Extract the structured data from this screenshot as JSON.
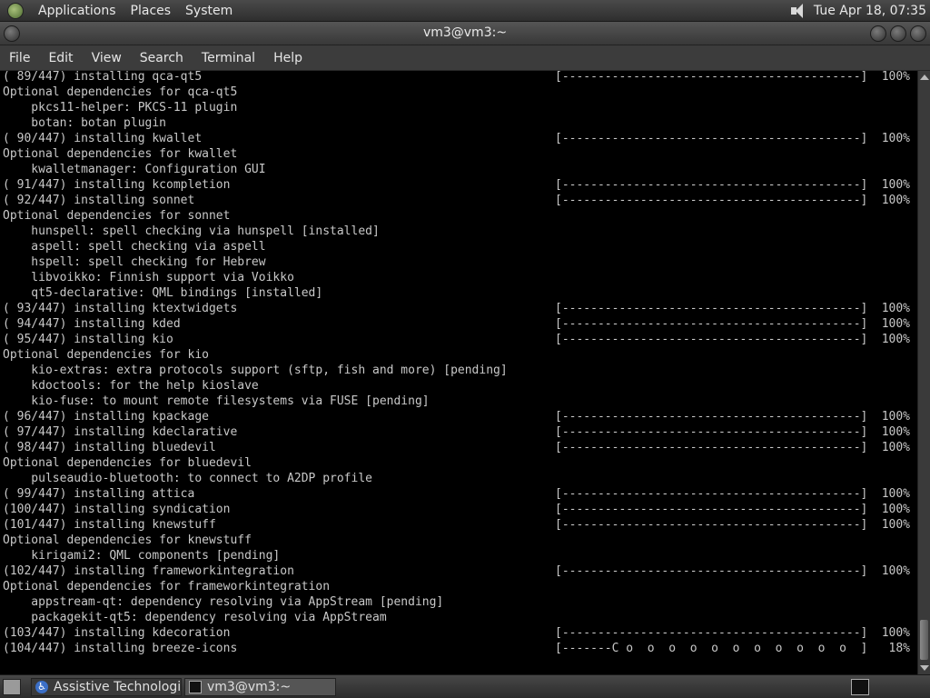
{
  "top_panel": {
    "menus": [
      "Applications",
      "Places",
      "System"
    ],
    "clock": "Tue Apr 18, 07:35"
  },
  "window": {
    "title": "vm3@vm3:~",
    "menubar": [
      "File",
      "Edit",
      "View",
      "Search",
      "Terminal",
      "Help"
    ]
  },
  "terminal_lines": [
    {
      "text": "( 89/447) installing qca-qt5",
      "bar": "[------------------------------------------]",
      "pct": "100%"
    },
    {
      "text": "Optional dependencies for qca-qt5"
    },
    {
      "text": "    pkcs11-helper: PKCS-11 plugin"
    },
    {
      "text": "    botan: botan plugin"
    },
    {
      "text": "( 90/447) installing kwallet",
      "bar": "[------------------------------------------]",
      "pct": "100%"
    },
    {
      "text": "Optional dependencies for kwallet"
    },
    {
      "text": "    kwalletmanager: Configuration GUI"
    },
    {
      "text": "( 91/447) installing kcompletion",
      "bar": "[------------------------------------------]",
      "pct": "100%"
    },
    {
      "text": "( 92/447) installing sonnet",
      "bar": "[------------------------------------------]",
      "pct": "100%"
    },
    {
      "text": "Optional dependencies for sonnet"
    },
    {
      "text": "    hunspell: spell checking via hunspell [installed]"
    },
    {
      "text": "    aspell: spell checking via aspell"
    },
    {
      "text": "    hspell: spell checking for Hebrew"
    },
    {
      "text": "    libvoikko: Finnish support via Voikko"
    },
    {
      "text": "    qt5-declarative: QML bindings [installed]"
    },
    {
      "text": "( 93/447) installing ktextwidgets",
      "bar": "[------------------------------------------]",
      "pct": "100%"
    },
    {
      "text": "( 94/447) installing kded",
      "bar": "[------------------------------------------]",
      "pct": "100%"
    },
    {
      "text": "( 95/447) installing kio",
      "bar": "[------------------------------------------]",
      "pct": "100%"
    },
    {
      "text": "Optional dependencies for kio"
    },
    {
      "text": "    kio-extras: extra protocols support (sftp, fish and more) [pending]"
    },
    {
      "text": "    kdoctools: for the help kioslave"
    },
    {
      "text": "    kio-fuse: to mount remote filesystems via FUSE [pending]"
    },
    {
      "text": "( 96/447) installing kpackage",
      "bar": "[------------------------------------------]",
      "pct": "100%"
    },
    {
      "text": "( 97/447) installing kdeclarative",
      "bar": "[------------------------------------------]",
      "pct": "100%"
    },
    {
      "text": "( 98/447) installing bluedevil",
      "bar": "[------------------------------------------]",
      "pct": "100%"
    },
    {
      "text": "Optional dependencies for bluedevil"
    },
    {
      "text": "    pulseaudio-bluetooth: to connect to A2DP profile"
    },
    {
      "text": "( 99/447) installing attica",
      "bar": "[------------------------------------------]",
      "pct": "100%"
    },
    {
      "text": "(100/447) installing syndication",
      "bar": "[------------------------------------------]",
      "pct": "100%"
    },
    {
      "text": "(101/447) installing knewstuff",
      "bar": "[------------------------------------------]",
      "pct": "100%"
    },
    {
      "text": "Optional dependencies for knewstuff"
    },
    {
      "text": "    kirigami2: QML components [pending]"
    },
    {
      "text": "(102/447) installing frameworkintegration",
      "bar": "[------------------------------------------]",
      "pct": "100%"
    },
    {
      "text": "Optional dependencies for frameworkintegration"
    },
    {
      "text": "    appstream-qt: dependency resolving via AppStream [pending]"
    },
    {
      "text": "    packagekit-qt5: dependency resolving via AppStream"
    },
    {
      "text": "(103/447) installing kdecoration",
      "bar": "[------------------------------------------]",
      "pct": "100%"
    },
    {
      "text": "(104/447) installing breeze-icons",
      "bar": "[-------C o  o  o  o  o  o  o  o  o  o  o  ]",
      "pct": "18%"
    }
  ],
  "taskbar": {
    "tasks": [
      "Assistive Technologi...",
      "vm3@vm3:~"
    ]
  }
}
